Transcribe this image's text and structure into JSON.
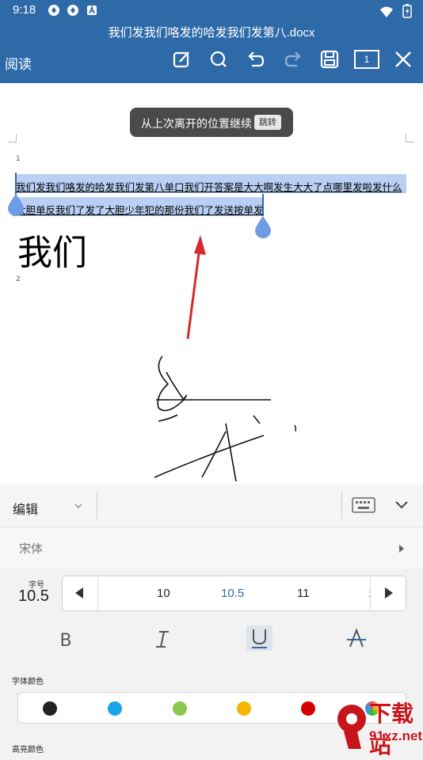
{
  "status": {
    "time": "9:18"
  },
  "titlebar": {
    "doc_title": "我们发我们咯发的哈发我们发第八.docx",
    "mode_label": "阅读",
    "page_badge": "1",
    "icons": [
      "edit-icon",
      "search-icon",
      "undo-icon",
      "redo-icon",
      "save-icon",
      "page-count-icon",
      "close-icon"
    ]
  },
  "document": {
    "toast_message": "从上次离开的位置继续",
    "toast_action": "跳转",
    "para_num_1": "1",
    "para_num_2": "2",
    "line1": "我们发我们咯发的哈发我们发第八单口我们开答案是大大啊发生大大了点哪里发啦发什么",
    "line2": "大胆单反我们了发了大胆少年犯的那份我们了发送按单发",
    "big_text": "我们"
  },
  "panel": {
    "edit_label": "编辑",
    "font_name": "宋体",
    "font_size_caption": "字号",
    "font_size_value": "10.5",
    "size_options": [
      "10",
      "10.5",
      "11",
      "1"
    ],
    "selected_size": "10.5",
    "font_color_label": "字体颜色",
    "highlight_label": "高亮颜色",
    "colors": {
      "accent": "#2f6aa8",
      "swatches": [
        "#222222",
        "#1aa3e8",
        "#8cc84b",
        "#f5b400",
        "#d40000"
      ]
    }
  },
  "watermark": {
    "text_main": "下载站",
    "text_sub": "91xz.net"
  }
}
